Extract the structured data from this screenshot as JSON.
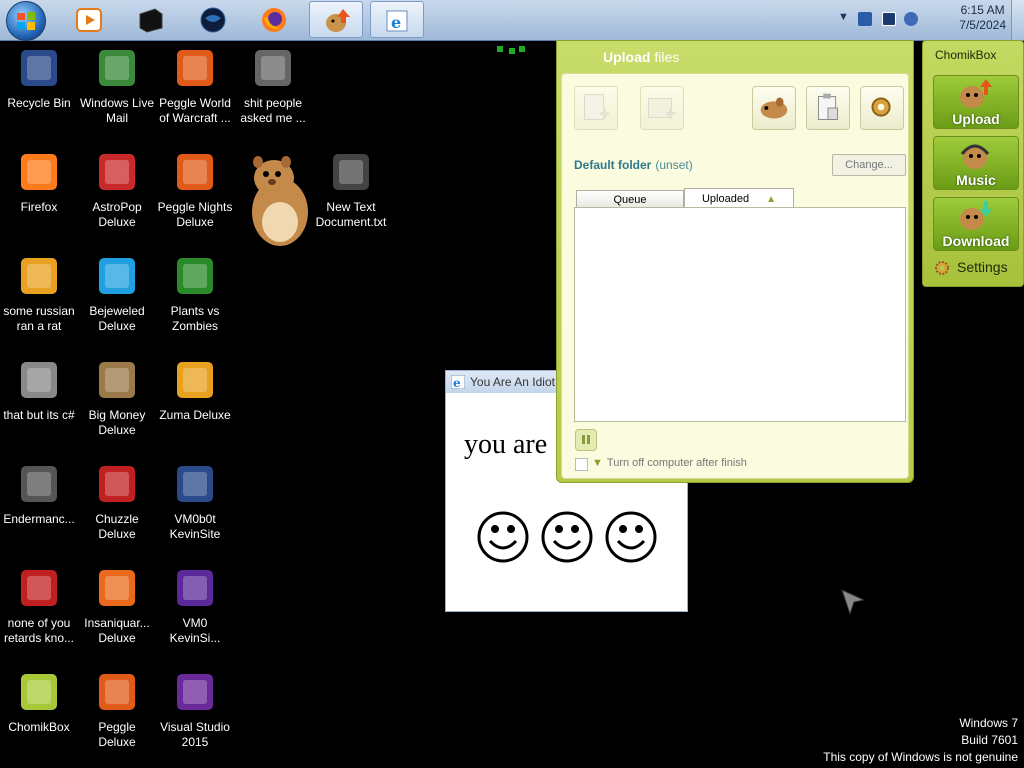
{
  "taskbar": {
    "pinned": [
      {
        "name": "media-player-icon"
      },
      {
        "name": "black-app-icon"
      },
      {
        "name": "globe-icon"
      },
      {
        "name": "firefox-icon"
      },
      {
        "name": "chomikbox-taskbar-icon"
      },
      {
        "name": "internet-explorer-icon"
      }
    ],
    "clock": {
      "time": "6:15 AM",
      "date": "7/5/2024"
    }
  },
  "desktop_icons": [
    {
      "label": "Recycle Bin",
      "icon": "recycle-bin-icon"
    },
    {
      "label": "Windows Live Mail",
      "icon": "live-mail-icon"
    },
    {
      "label": "Peggle World of Warcraft ...",
      "icon": "peggle-wow-icon"
    },
    {
      "label": "shit people asked me ...",
      "icon": "folder-icon"
    },
    {
      "label": "Firefox",
      "icon": "firefox-icon"
    },
    {
      "label": "AstroPop Deluxe",
      "icon": "astropop-icon"
    },
    {
      "label": "Peggle Nights Deluxe",
      "icon": "peggle-nights-icon"
    },
    {
      "label": "New Text Document.txt",
      "icon": "text-document-icon"
    },
    {
      "label": "some russian ran a rat",
      "icon": "rat-file-icon"
    },
    {
      "label": "Bejeweled Deluxe",
      "icon": "bejeweled-icon"
    },
    {
      "label": "Plants vs Zombies",
      "icon": "plants-vs-zombies-icon"
    },
    {
      "label": "that but its c#",
      "icon": "shortcut-icon"
    },
    {
      "label": "Big Money Deluxe",
      "icon": "big-money-icon"
    },
    {
      "label": "Zuma Deluxe",
      "icon": "zuma-icon"
    },
    {
      "label": "Endermanc...",
      "icon": "endermanch-icon"
    },
    {
      "label": "Chuzzle Deluxe",
      "icon": "chuzzle-icon"
    },
    {
      "label": "VM0b0t KevinSite",
      "icon": "vm-icon"
    },
    {
      "label": "none of you retards kno...",
      "icon": "unknown-file-icon"
    },
    {
      "label": "Insaniquar... Deluxe",
      "icon": "insaniquarium-icon"
    },
    {
      "label": "VM0 KevinSi...",
      "icon": "vm-icon-2"
    },
    {
      "label": "ChomikBox",
      "icon": "chomikbox-icon"
    },
    {
      "label": "Peggle Deluxe",
      "icon": "peggle-icon"
    },
    {
      "label": "Visual Studio 2015",
      "icon": "visual-studio-icon"
    }
  ],
  "idiot_window": {
    "title": "You Are An Idiot",
    "text": "you are"
  },
  "upload_window": {
    "title_bold": "Upload",
    "title_rest": " files",
    "default_folder_label": "Default folder",
    "default_folder_value": "(unset)",
    "change_button": "Change...",
    "tabs": [
      "Queue",
      "Uploaded"
    ],
    "turn_off_label": "Turn off computer after finish"
  },
  "side_panel": {
    "brand": "ChomikBox",
    "buttons": [
      "Upload",
      "Music",
      "Download"
    ],
    "settings": "Settings"
  },
  "watermark": {
    "line1": "Windows 7",
    "line2": "Build 7601",
    "line3": "This copy of Windows is not genuine"
  },
  "colors": {
    "chomik_green": "#b4cc45",
    "taskbar": "#b5cae3"
  }
}
